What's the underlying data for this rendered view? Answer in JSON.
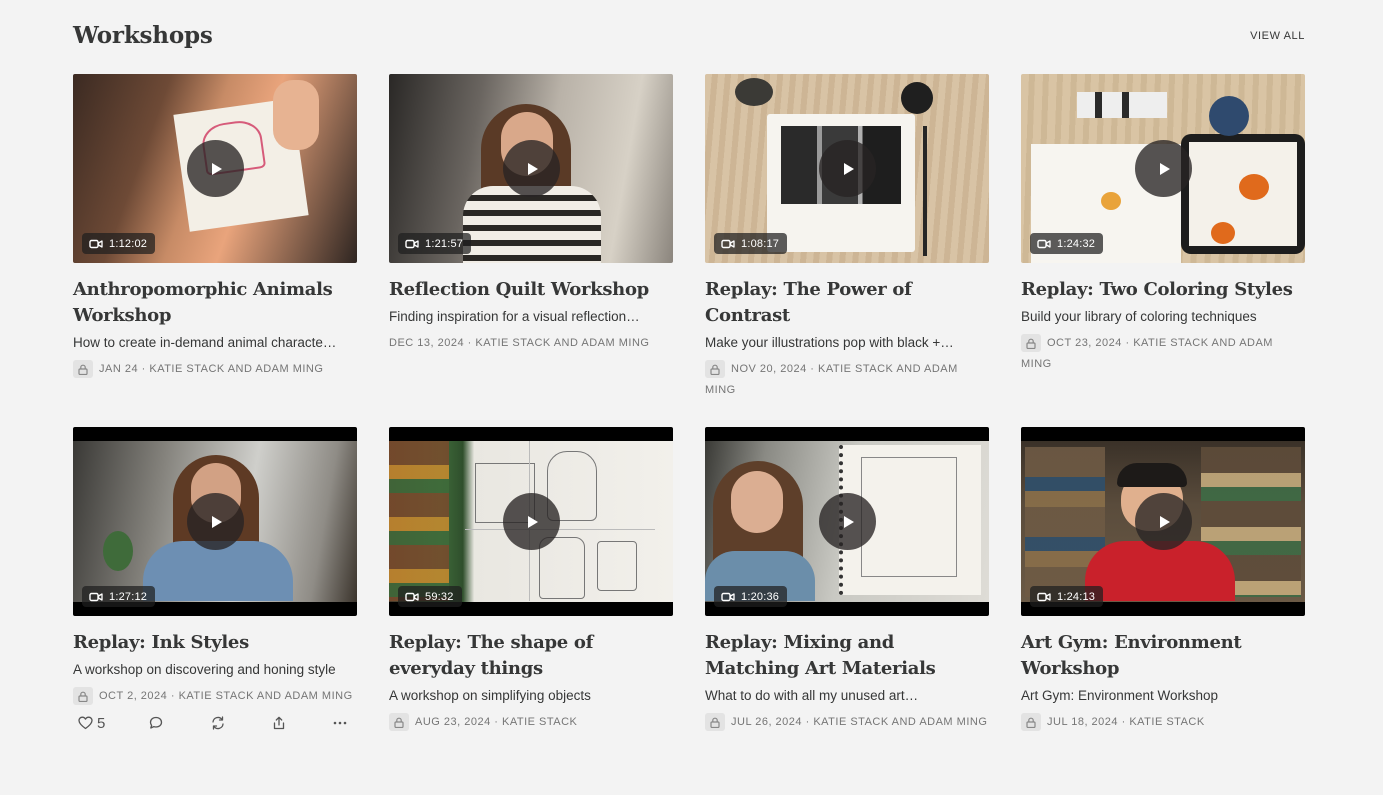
{
  "section": {
    "title": "Workshops",
    "view_all": "VIEW ALL"
  },
  "workshops": [
    {
      "title": "Anthropomorphic Animals Workshop",
      "subtitle": "How to create in-demand animal characte…",
      "date": "JAN 24",
      "authors": "KATIE STACK AND ADAM MING",
      "duration": "1:12:02",
      "locked": true
    },
    {
      "title": "Reflection Quilt Workshop",
      "subtitle": "Finding inspiration for a visual reflection…",
      "date": "DEC 13, 2024",
      "authors": "KATIE STACK AND ADAM MING",
      "duration": "1:21:57",
      "locked": false
    },
    {
      "title": "Replay: The Power of Contrast",
      "subtitle": "Make your illustrations pop with black +…",
      "date": "NOV 20, 2024",
      "authors": "KATIE STACK AND ADAM MING",
      "duration": "1:08:17",
      "locked": true
    },
    {
      "title": "Replay: Two Coloring Styles",
      "subtitle": "Build your library of coloring techniques",
      "date": "OCT 23, 2024",
      "authors": "KATIE STACK AND ADAM MING",
      "duration": "1:24:32",
      "locked": true
    },
    {
      "title": "Replay: Ink Styles",
      "subtitle": "A workshop on discovering and honing style",
      "date": "OCT 2, 2024",
      "authors": "KATIE STACK AND ADAM MING",
      "duration": "1:27:12",
      "locked": true,
      "likes": "5"
    },
    {
      "title": "Replay: The shape of everyday things",
      "subtitle": "A workshop on simplifying objects",
      "date": "AUG 23, 2024",
      "authors": "KATIE STACK",
      "duration": "59:32",
      "locked": true
    },
    {
      "title": "Replay: Mixing and Matching Art Materials",
      "subtitle": "What to do with all my unused art…",
      "date": "JUL 26, 2024",
      "authors": "KATIE STACK AND ADAM MING",
      "duration": "1:20:36",
      "locked": true
    },
    {
      "title": "Art Gym: Environment Workshop",
      "subtitle": "Art Gym: Environment Workshop",
      "date": "JUL 18, 2024",
      "authors": "KATIE STACK",
      "duration": "1:24:13",
      "locked": true
    }
  ],
  "icons": {
    "play": "play-icon",
    "duration": "video-camera-icon",
    "lock": "lock-icon",
    "like": "heart-icon",
    "comment": "comment-icon",
    "restack": "restack-icon",
    "share": "share-icon",
    "more": "more-icon"
  }
}
